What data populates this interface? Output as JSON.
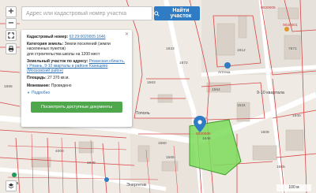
{
  "search": {
    "placeholder": "Адрес или кадастровый номер участка",
    "button_label": "Найти участок"
  },
  "controls": {
    "zoom_in": "+",
    "zoom_out": "−"
  },
  "parcel_popup": {
    "cadastral_label": "Кадастровый номер:",
    "cadastral_number": "62:29:0020005:1646",
    "category_label": "Категория земель:",
    "category_value": "Земли поселений (земли населенных пунктов)",
    "use_value": "для строительства школы на 1200 мест",
    "address_label": "Земельный участок по адресу:",
    "address_value": "Рязанская область, г Рязань, 9-10 кварталы в районе Канищево (Московский район)",
    "area_label": "Площадь:",
    "area_value": "27 370 кв.м.",
    "survey_label": "Межевание:",
    "survey_value": "Проведено",
    "more_link": "Подробно",
    "show_docs_button": "Посмотреть доступные документы"
  },
  "map_labels": {
    "zone_id_top": "0020005",
    "zone_id_top2": "0020001",
    "zone_id_mid": "0020005",
    "quarter_label": "9-10 квартала",
    "poplar_label": "Тополь",
    "energetik_label": "Энергетик",
    "ekola_label": "Экола",
    "pharmacy_label": "Аптека",
    "selected_number": "1646",
    "numbers": [
      "1633",
      "1672",
      "1563",
      "1534",
      "1564",
      "1560",
      "1565",
      "1608",
      "1565",
      "1656",
      "4003",
      "1649",
      "7671",
      "1612",
      "1640"
    ]
  },
  "parcel_highlight_color": "#7ddc5b",
  "accent_color": "#2f7cc4",
  "scale": {
    "text": "100 м"
  }
}
